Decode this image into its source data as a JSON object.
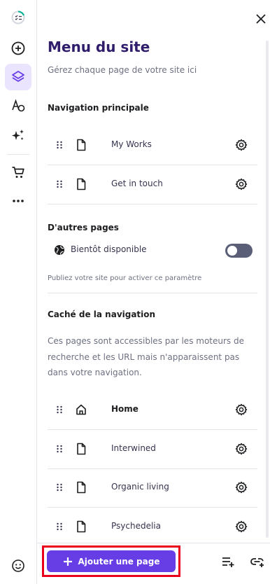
{
  "sidebar": {
    "items": [
      {
        "icon": "checklist-progress-icon"
      },
      {
        "icon": "add-circle-icon"
      },
      {
        "icon": "layers-icon",
        "active": true
      },
      {
        "icon": "typography-palette-icon"
      },
      {
        "icon": "ai-sparkles-icon"
      },
      {
        "icon": "cart-icon"
      },
      {
        "icon": "more-horizontal-icon"
      }
    ],
    "bottom_icon": "smiley-icon"
  },
  "panel": {
    "title": "Menu du site",
    "subtitle": "Gérez chaque page de votre site ici",
    "main_nav": {
      "heading": "Navigation principale",
      "pages": [
        {
          "label": "My Works"
        },
        {
          "label": "Get in touch"
        }
      ]
    },
    "other_pages": {
      "heading": "D'autres pages",
      "toggle_label": "Bientôt disponible",
      "toggle_on": false,
      "helper": "Publiez votre site pour activer ce paramètre"
    },
    "hidden": {
      "heading": "Caché de la navigation",
      "description": "Ces pages sont accessibles par les moteurs de recherche et les URL mais n'apparaissent pas dans votre navigation.",
      "pages": [
        {
          "label": "Home",
          "icon": "home-icon"
        },
        {
          "label": "Interwined",
          "icon": "page-icon"
        },
        {
          "label": "Organic living",
          "icon": "page-icon"
        },
        {
          "label": "Psychedelia",
          "icon": "page-icon"
        }
      ]
    }
  },
  "footer": {
    "add_button": "Ajouter une page"
  },
  "colors": {
    "accent": "#673de6",
    "active_bg": "#ebe4ff",
    "highlight_border": "#e8001c"
  }
}
